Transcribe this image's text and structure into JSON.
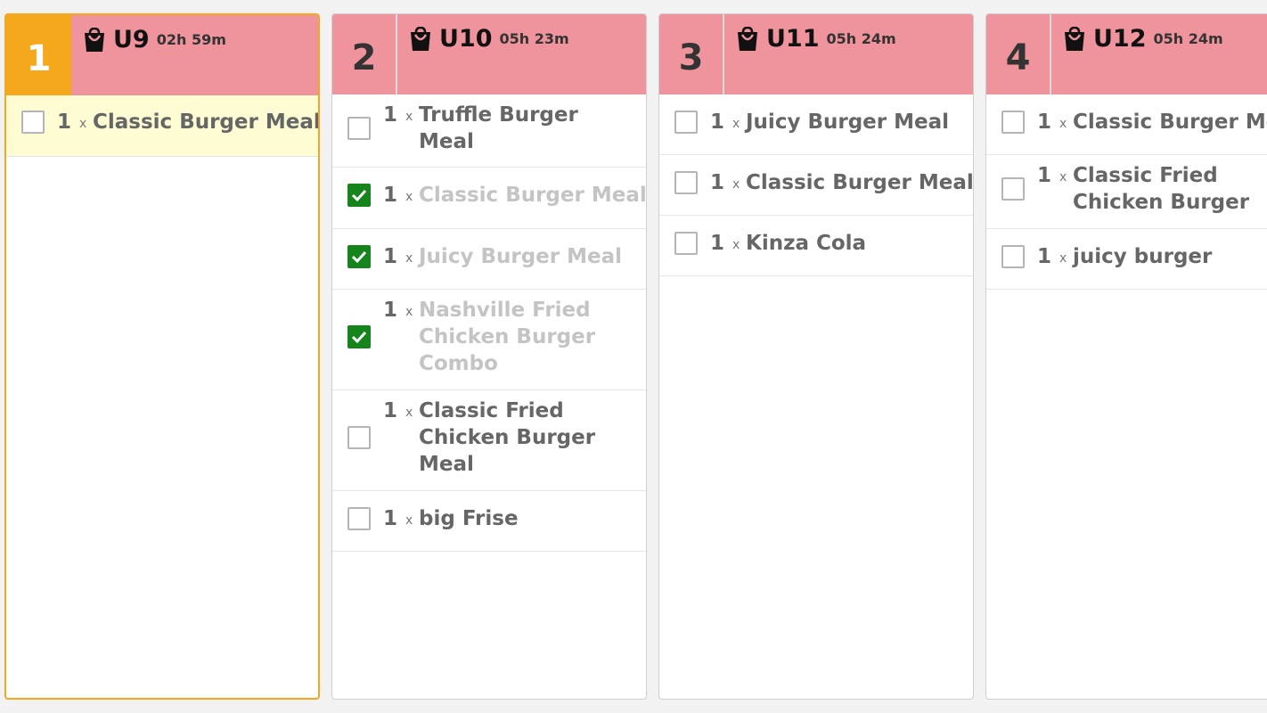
{
  "tickets": [
    {
      "number": "1",
      "label": "U9",
      "time": "02h 59m",
      "selected": true,
      "items": [
        {
          "qty": "1",
          "x": "x",
          "name": "Classic Burger Meal",
          "checked": false
        }
      ]
    },
    {
      "number": "2",
      "label": "U10",
      "time": "05h 23m",
      "selected": false,
      "items": [
        {
          "qty": "1",
          "x": "x",
          "name_lines": [
            "Truffle Burger",
            "Meal"
          ],
          "checked": false
        },
        {
          "qty": "1",
          "x": "x",
          "name": "Classic Burger Meal",
          "checked": true
        },
        {
          "qty": "1",
          "x": "x",
          "name": "Juicy Burger Meal",
          "checked": true
        },
        {
          "qty": "1",
          "x": "x",
          "name_lines": [
            "Nashville Fried",
            "Chicken Burger",
            "Combo"
          ],
          "checked": true
        },
        {
          "qty": "1",
          "x": "x",
          "name_lines": [
            "Classic Fried",
            "Chicken Burger",
            "Meal"
          ],
          "checked": false
        },
        {
          "qty": "1",
          "x": "x",
          "name": "big Frise",
          "checked": false
        }
      ]
    },
    {
      "number": "3",
      "label": "U11",
      "time": "05h 24m",
      "selected": false,
      "items": [
        {
          "qty": "1",
          "x": "x",
          "name": "Juicy Burger Meal",
          "checked": false
        },
        {
          "qty": "1",
          "x": "x",
          "name": "Classic Burger Meal",
          "checked": false
        },
        {
          "qty": "1",
          "x": "x",
          "name": "Kinza Cola",
          "checked": false
        }
      ]
    },
    {
      "number": "4",
      "label": "U12",
      "time": "05h 24m",
      "selected": false,
      "items": [
        {
          "qty": "1",
          "x": "x",
          "name": "Classic Burger Me",
          "checked": false
        },
        {
          "qty": "1",
          "x": "x",
          "name_lines": [
            "Classic Fried",
            "Chicken Burger"
          ],
          "checked": false
        },
        {
          "qty": "1",
          "x": "x",
          "name": "juicy burger",
          "checked": false
        }
      ]
    }
  ],
  "icons": {
    "order_type": "shopping-bag-icon",
    "checked": "checkmark-icon"
  },
  "colors": {
    "header": "#ef949c",
    "selected_accent": "#f5a81c",
    "highlight_row": "#fdfcd2",
    "checked": "#15841a"
  }
}
